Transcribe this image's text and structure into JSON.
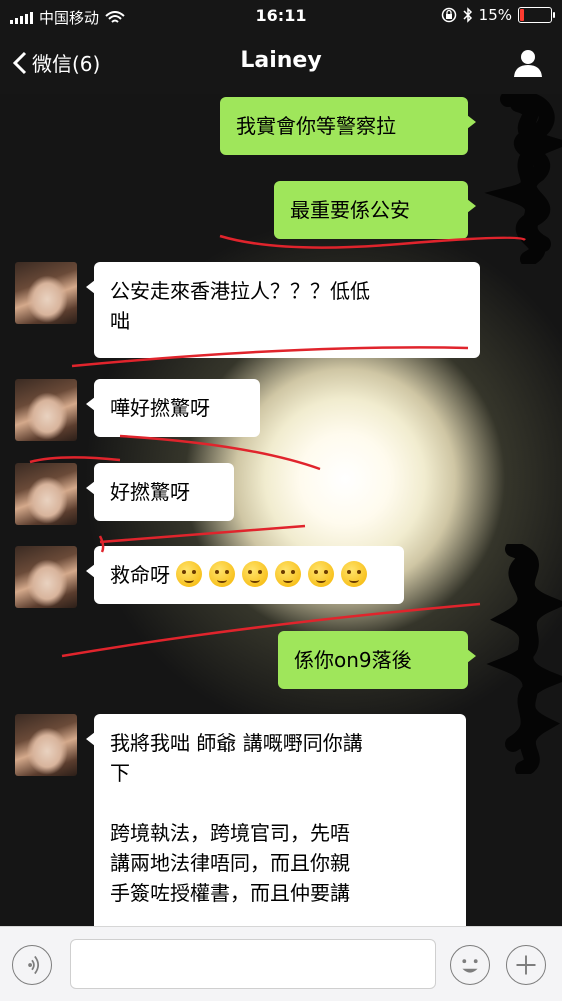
{
  "status_bar": {
    "carrier": "中国移动",
    "time": "16:11",
    "battery": "15%",
    "battery_level": 0.15
  },
  "nav": {
    "back_label": "微信(6)",
    "title": "Lainey"
  },
  "messages": [
    {
      "from": "me",
      "text": "我實會你等警察拉"
    },
    {
      "from": "me",
      "text": "最重要係公安"
    },
    {
      "from": "other",
      "text": "公安走來香港拉人？？？低低\n咄"
    },
    {
      "from": "other",
      "text": "嘩好撚驚呀"
    },
    {
      "from": "other",
      "text": "好撚驚呀"
    },
    {
      "from": "other",
      "text": "救命呀",
      "emoji_icons": [
        "thinking-face-emoji",
        "thinking-face-emoji",
        "thinking-face-emoji",
        "thinking-face-emoji",
        "thinking-face-emoji",
        "thinking-face-emoji"
      ]
    },
    {
      "from": "me",
      "text": "係你on9落後"
    },
    {
      "from": "other",
      "text": "我將我咄 師爺 講嘅嘢同你講\n下\n\n跨境執法，跨境官司，先唔\n講兩地法律唔同，而且你親\n手簽咗授權書，而且仲要講"
    }
  ],
  "colors": {
    "my_bubble": "#9fe65b",
    "other_bubble": "#ffffff",
    "bar": "#161616",
    "scribble": "#e0242c"
  }
}
